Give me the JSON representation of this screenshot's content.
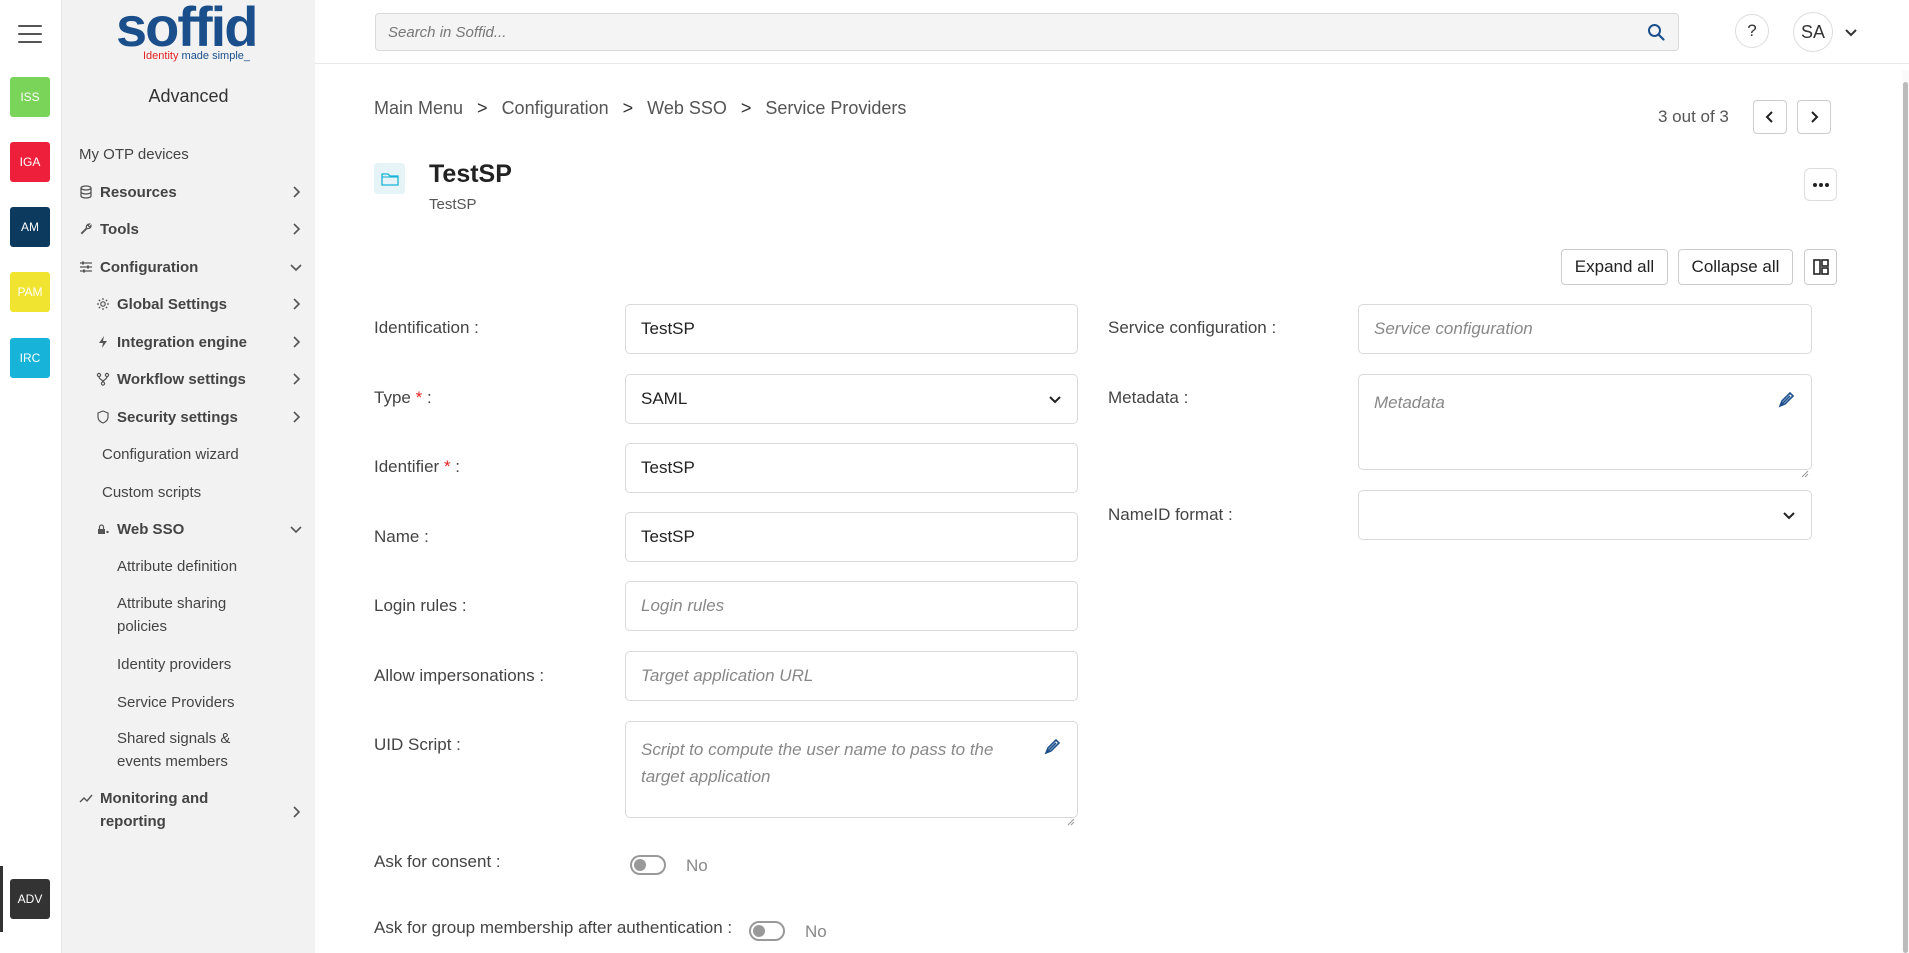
{
  "rail": {
    "modules": [
      {
        "label": "ISS",
        "color": "#7bd45a"
      },
      {
        "label": "IGA",
        "color": "#ee1f3b"
      },
      {
        "label": "AM",
        "color": "#0b3a5e"
      },
      {
        "label": "PAM",
        "color": "#f1e431"
      },
      {
        "label": "IRC",
        "color": "#17b3d8"
      }
    ],
    "active_module": {
      "label": "ADV",
      "color": "#333333"
    }
  },
  "logo": {
    "name": "soffid",
    "tagline_red": "Identity",
    "tagline_blue": " made simple_"
  },
  "sidebar": {
    "heading": "Advanced",
    "items": {
      "otp": "My OTP devices",
      "resources": "Resources",
      "tools": "Tools",
      "configuration": "Configuration",
      "global_settings": "Global Settings",
      "integration_engine": "Integration engine",
      "workflow_settings": "Workflow settings",
      "security_settings": "Security settings",
      "configuration_wizard": "Configuration wizard",
      "custom_scripts": "Custom scripts",
      "web_sso": "Web SSO",
      "attribute_definition": "Attribute definition",
      "attribute_sharing_1": "Attribute sharing",
      "attribute_sharing_2": "policies",
      "identity_providers": "Identity providers",
      "service_providers": "Service Providers",
      "shared_signals_1": "Shared signals &",
      "shared_signals_2": "events members",
      "monitoring_1": "Monitoring and",
      "monitoring_2": "reporting"
    }
  },
  "topbar": {
    "search_placeholder": "Search in Soffid...",
    "help_label": "?",
    "avatar_initials": "SA"
  },
  "breadcrumb": {
    "items": [
      "Main Menu",
      "Configuration",
      "Web SSO",
      "Service Providers"
    ],
    "separator": ">"
  },
  "pager": {
    "text": "3 out of 3"
  },
  "object": {
    "title": "TestSP",
    "subtitle": "TestSP"
  },
  "actions": {
    "expand_all": "Expand all",
    "collapse_all": "Collapse all"
  },
  "form": {
    "identification": {
      "label": "Identification :",
      "value": "TestSP"
    },
    "type": {
      "label": "Type",
      "suffix": " :",
      "value": "SAML"
    },
    "identifier": {
      "label": "Identifier",
      "suffix": " :",
      "value": "TestSP"
    },
    "name": {
      "label": "Name :",
      "value": "TestSP"
    },
    "login_rules": {
      "label": "Login rules :",
      "placeholder": "Login rules"
    },
    "allow_impersonations": {
      "label": "Allow impersonations :",
      "placeholder": "Target application URL"
    },
    "uid_script": {
      "label": "UID Script :",
      "placeholder_line1": "Script to compute the user name to pass to the",
      "placeholder_line2": "target application"
    },
    "ask_consent": {
      "label": "Ask for consent :",
      "value": "No"
    },
    "ask_group": {
      "label": "Ask for group membership after authentication :",
      "value": "No"
    },
    "service_configuration": {
      "label": "Service configuration :",
      "placeholder": "Service configuration"
    },
    "metadata": {
      "label": "Metadata :",
      "placeholder": "Metadata"
    },
    "nameid_format": {
      "label": "NameID format :",
      "value": ""
    }
  },
  "required_marker": "*"
}
